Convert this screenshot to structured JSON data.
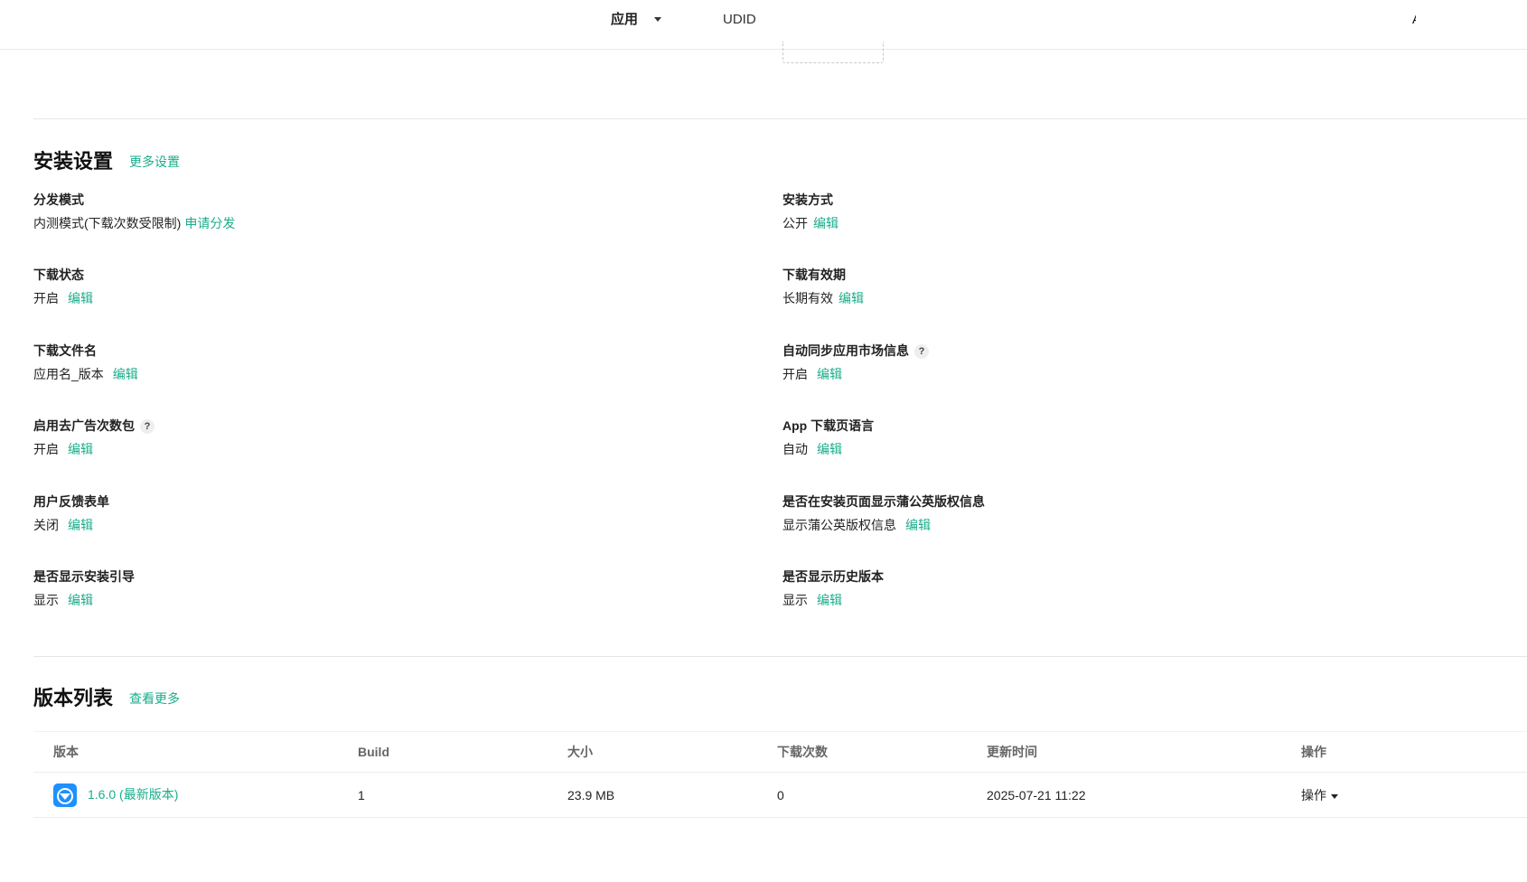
{
  "nav": {
    "app_label": "应用",
    "udid_label": "UDID",
    "edge_mark": "A"
  },
  "install_settings": {
    "title": "安装设置",
    "more_link": "更多设置",
    "items": [
      {
        "label": "分发模式",
        "value": "内测模式(下载次数受限制)",
        "action": "申请分发"
      },
      {
        "label": "安装方式",
        "value": "公开",
        "action": "编辑"
      },
      {
        "label": "下载状态",
        "value": "开启",
        "action": "编辑"
      },
      {
        "label": "下载有效期",
        "value": "长期有效",
        "action": "编辑"
      },
      {
        "label": "下载文件名",
        "value": "应用名_版本",
        "action": "编辑"
      },
      {
        "label": "自动同步应用市场信息",
        "value": "开启",
        "action": "编辑",
        "help": "?"
      },
      {
        "label": "启用去广告次数包",
        "value": "开启",
        "action": "编辑",
        "help": "?"
      },
      {
        "label": "App 下载页语言",
        "value": "自动",
        "action": "编辑"
      },
      {
        "label": "用户反馈表单",
        "value": "关闭",
        "action": "编辑"
      },
      {
        "label": "是否在安装页面显示蒲公英版权信息",
        "value": "显示蒲公英版权信息",
        "action": "编辑"
      },
      {
        "label": "是否显示安装引导",
        "value": "显示",
        "action": "编辑"
      },
      {
        "label": "是否显示历史版本",
        "value": "显示",
        "action": "编辑"
      }
    ]
  },
  "version_list": {
    "title": "版本列表",
    "more_link": "查看更多",
    "columns": [
      "版本",
      "Build",
      "大小",
      "下载次数",
      "更新时间",
      "操作"
    ],
    "rows": [
      {
        "version": "1.6.0 (最新版本)",
        "build": "1",
        "size": "23.9 MB",
        "downloads": "0",
        "updated": "2025-07-21 11:22",
        "action": "操作"
      }
    ]
  },
  "colors": {
    "accent": "#1aad8b",
    "app_icon": "#1e90ff"
  }
}
